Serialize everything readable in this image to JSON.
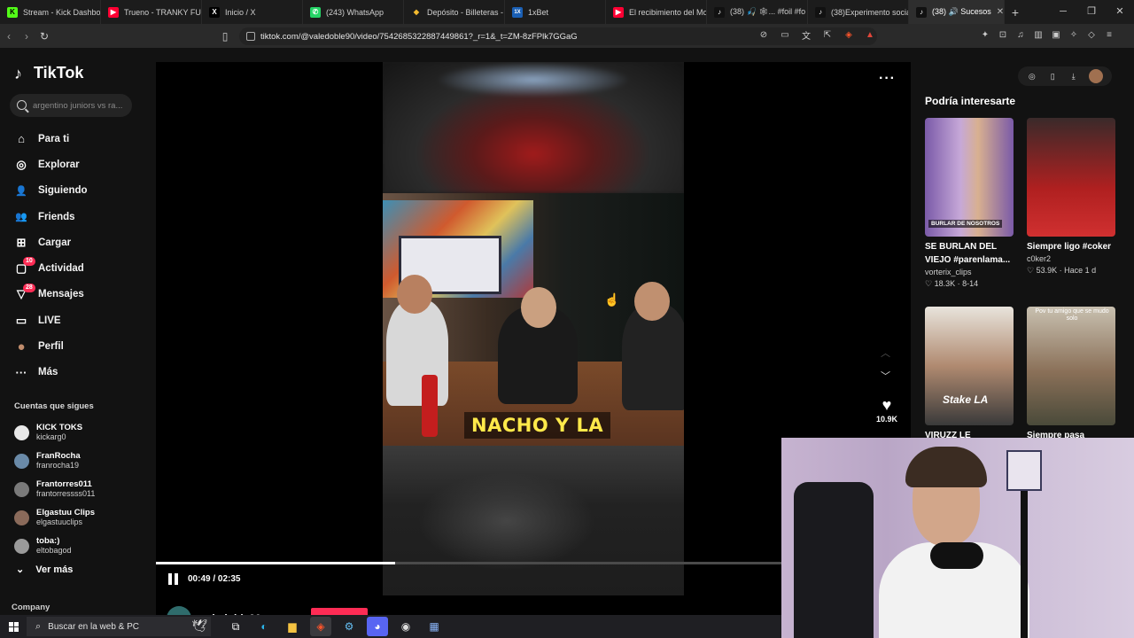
{
  "browser": {
    "tabs": [
      {
        "label": "Stream - Kick Dashbo",
        "icon": "kick-icon",
        "color": "#53fc18",
        "glyph": "K"
      },
      {
        "label": "Trueno - TRANKY FUN",
        "icon": "youtube-icon",
        "color": "#ff0033",
        "glyph": "▶"
      },
      {
        "label": "Inicio / X",
        "icon": "x-icon",
        "color": "#000000",
        "glyph": "X"
      },
      {
        "label": "(243) WhatsApp",
        "icon": "whatsapp-icon",
        "color": "#25d366",
        "glyph": "✆"
      },
      {
        "label": "Depósito - Billeteras -",
        "icon": "binance-icon",
        "color": "#f3ba2f",
        "glyph": "◆"
      },
      {
        "label": "1xBet",
        "icon": "1xbet-icon",
        "color": "#1a5fb4",
        "glyph": "1X"
      },
      {
        "label": "El recibimiento del Mo",
        "icon": "youtube-icon",
        "color": "#ff0033",
        "glyph": "▶"
      },
      {
        "label": "(38) 🎣 🕸... #foil #fo",
        "icon": "tiktok-icon",
        "color": "#111111",
        "glyph": "♪"
      },
      {
        "label": "(38)Experimento social",
        "icon": "tiktok-icon",
        "color": "#111111",
        "glyph": "♪"
      },
      {
        "label": "(38) 🔊 Sucesos",
        "icon": "tiktok-icon",
        "color": "#111111",
        "glyph": "♪",
        "active": true
      }
    ],
    "url": "tiktok.com/@valedoble90/video/7542685322887449861?_r=1&_t=ZM-8zFPlk7GGaG"
  },
  "sidebar": {
    "logo": "TikTok",
    "search_placeholder": "argentino juniors vs ra...",
    "nav": [
      {
        "label": "Para ti",
        "icon": "home-icon",
        "glyph": "⌂"
      },
      {
        "label": "Explorar",
        "icon": "compass-icon",
        "glyph": "◎"
      },
      {
        "label": "Siguiendo",
        "icon": "following-icon",
        "glyph": "👤"
      },
      {
        "label": "Friends",
        "icon": "friends-icon",
        "glyph": "👥"
      },
      {
        "label": "Cargar",
        "icon": "upload-icon",
        "glyph": "⊞"
      },
      {
        "label": "Actividad",
        "icon": "activity-icon",
        "glyph": "▢",
        "badge": "10"
      },
      {
        "label": "Mensajes",
        "icon": "messages-icon",
        "glyph": "▽",
        "badge": "28"
      },
      {
        "label": "LIVE",
        "icon": "live-icon",
        "glyph": "▭"
      },
      {
        "label": "Perfil",
        "icon": "profile-avatar-icon",
        "glyph": "●"
      },
      {
        "label": "Más",
        "icon": "more-icon",
        "glyph": "···"
      }
    ],
    "following_title": "Cuentas que sigues",
    "following": [
      {
        "name": "KICK TOKS",
        "handle": "kickarg0"
      },
      {
        "name": "FranRocha",
        "handle": "franrocha19"
      },
      {
        "name": "Frantorres011",
        "handle": "frantorressss011"
      },
      {
        "name": "Elgastuu Clips",
        "handle": "elgastuuclips"
      },
      {
        "name": "toba:)",
        "handle": "eltobagod"
      }
    ],
    "see_more": "Ver más",
    "company": "Company"
  },
  "video": {
    "caption": "NACHO Y LA",
    "likes": "10.9K",
    "time": "00:49 / 02:35",
    "progress": 0.38,
    "author": "valedoble90"
  },
  "suggestions": {
    "title": "Podría interesarte",
    "cards": [
      {
        "title": "SE BURLAN DEL VIEJO #parenlama...",
        "user": "vorterix_clips",
        "stats": "♡ 18.3K · 8-14",
        "overlay": "BURLAR DE NOSOTROS"
      },
      {
        "title": "Siempre ligo #coker",
        "user": "c0ker2",
        "stats": "♡ 53.9K · Hace 1 d",
        "overlay": ""
      },
      {
        "title": "VIRUZZ LE CANCELO",
        "user": "",
        "stats": "",
        "overlay": "Stake LA"
      },
      {
        "title": "Siempre pasa",
        "user": "",
        "stats": "",
        "overlay": "Pov tu amigo que se mudo solo"
      }
    ]
  },
  "taskbar": {
    "search_placeholder": "Buscar en la web & PC"
  }
}
